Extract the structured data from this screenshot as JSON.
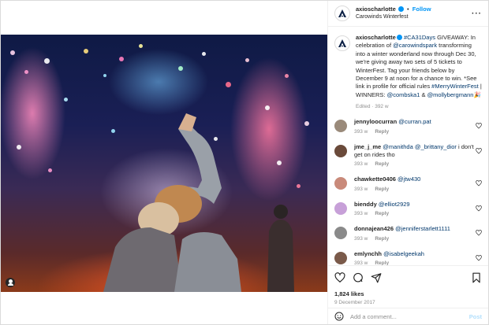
{
  "header": {
    "username": "axioscharlotte",
    "follow_label": "Follow",
    "location": "Carowinds Winterfest",
    "more_icon": "ellipsis-icon"
  },
  "caption": {
    "username": "axioscharlotte",
    "text_1": "#CA31Days",
    "text_2": " GIVEAWAY: In celebration of ",
    "text_3": "@carowindspark",
    "text_4": " transforming into a winter wonderland now through Dec 30, we're giving away two sets of 5 tickets to WinterFest. Tag your friends below by December 9 at noon for a chance to win. *See link in profile for official rules ",
    "text_5": "#MerryWinterFest",
    "text_6": " | WINNERS: ",
    "text_7": "@combska1",
    "text_8": " & ",
    "text_9": "@mollybergmann",
    "emoji": "🎉",
    "meta": "Edited · 392 w"
  },
  "comments": [
    {
      "user": "jennyloocurran",
      "mention": "@curran.pat",
      "text": "",
      "age": "393 w",
      "reply": "Reply",
      "avatar_color": "#9a8a7a"
    },
    {
      "user": "jme_j_me",
      "mention": "@manithda @_brittany_dior",
      "text": " i don't get on rides tho",
      "age": "393 w",
      "reply": "Reply",
      "avatar_color": "#6a4a3a"
    },
    {
      "user": "chawkette0406",
      "mention": "@jtw430",
      "text": "",
      "age": "393 w",
      "reply": "Reply",
      "avatar_color": "#c98a7a"
    },
    {
      "user": "bienddy",
      "mention": "@elliot2929",
      "text": "",
      "age": "393 w",
      "reply": "Reply",
      "avatar_color": "#c7a0d8"
    },
    {
      "user": "donnajean426",
      "mention": "@jenniferstarlett1111",
      "text": "",
      "age": "393 w",
      "reply": "Reply",
      "avatar_color": "#8a8a8a"
    },
    {
      "user": "emlynchh",
      "mention": "@isabelgeekah",
      "text": "",
      "age": "393 w",
      "reply": "Reply",
      "avatar_color": "#7a5a4a"
    }
  ],
  "actions": {
    "likes": "1,824 likes",
    "date": "9 December 2017"
  },
  "add_comment": {
    "placeholder": "Add a comment...",
    "post_label": "Post"
  },
  "colors": {
    "link": "#00376b",
    "accent": "#0095f6",
    "muted": "#8e8e8e"
  }
}
